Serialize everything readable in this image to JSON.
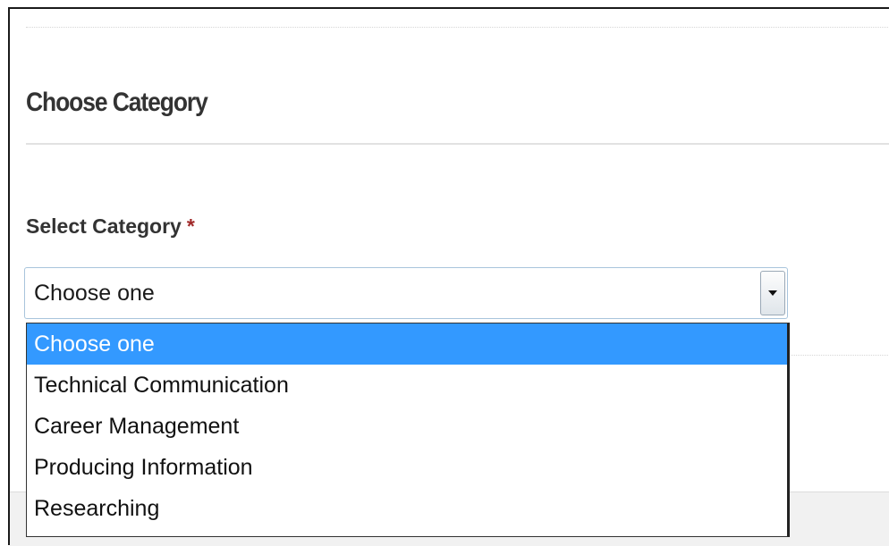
{
  "section": {
    "title": "Choose Category"
  },
  "field": {
    "label": "Select Category",
    "required_mark": "*",
    "selected_value": "Choose one"
  },
  "dropdown": {
    "options": [
      {
        "label": "Choose one",
        "selected": true
      },
      {
        "label": "Technical Communication",
        "selected": false
      },
      {
        "label": "Career Management",
        "selected": false
      },
      {
        "label": "Producing Information",
        "selected": false
      },
      {
        "label": "Researching",
        "selected": false
      }
    ]
  },
  "colors": {
    "selected_option_bg": "#3399ff",
    "required_star": "#a12a2a",
    "heading_text": "#333333"
  },
  "icons": {
    "select_toggle": "chevron-down-icon"
  }
}
